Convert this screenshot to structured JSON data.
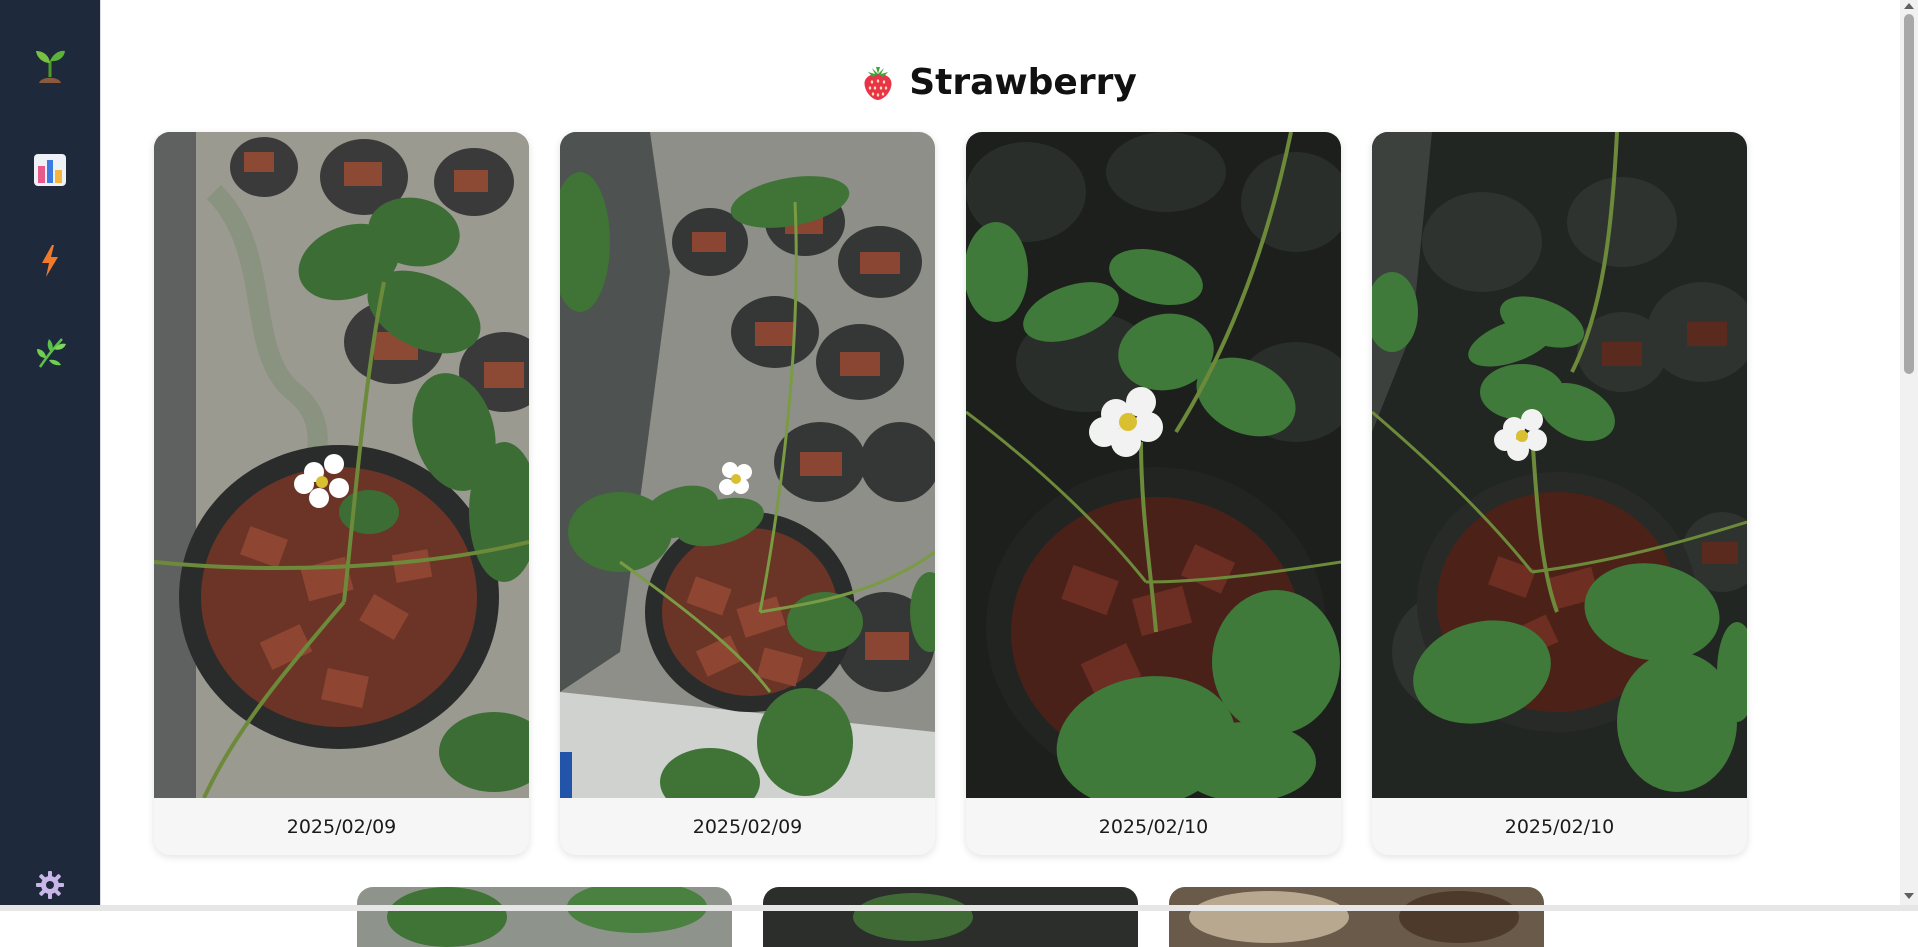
{
  "sidebar": {
    "items": [
      {
        "icon": "seedling-icon"
      },
      {
        "icon": "bar-chart-icon"
      },
      {
        "icon": "lightning-icon"
      },
      {
        "icon": "herb-icon"
      }
    ],
    "settings_icon": "gear-icon"
  },
  "header": {
    "icon": "strawberry-icon",
    "title": "Strawberry"
  },
  "gallery": {
    "cards": [
      {
        "date": "2025/02/09"
      },
      {
        "date": "2025/02/09"
      },
      {
        "date": "2025/02/10"
      },
      {
        "date": "2025/02/10"
      }
    ]
  },
  "colors": {
    "sidebar_bg": "#1e2a3c",
    "card_bg": "#f6f6f6",
    "accent_green": "#5cc04a"
  }
}
